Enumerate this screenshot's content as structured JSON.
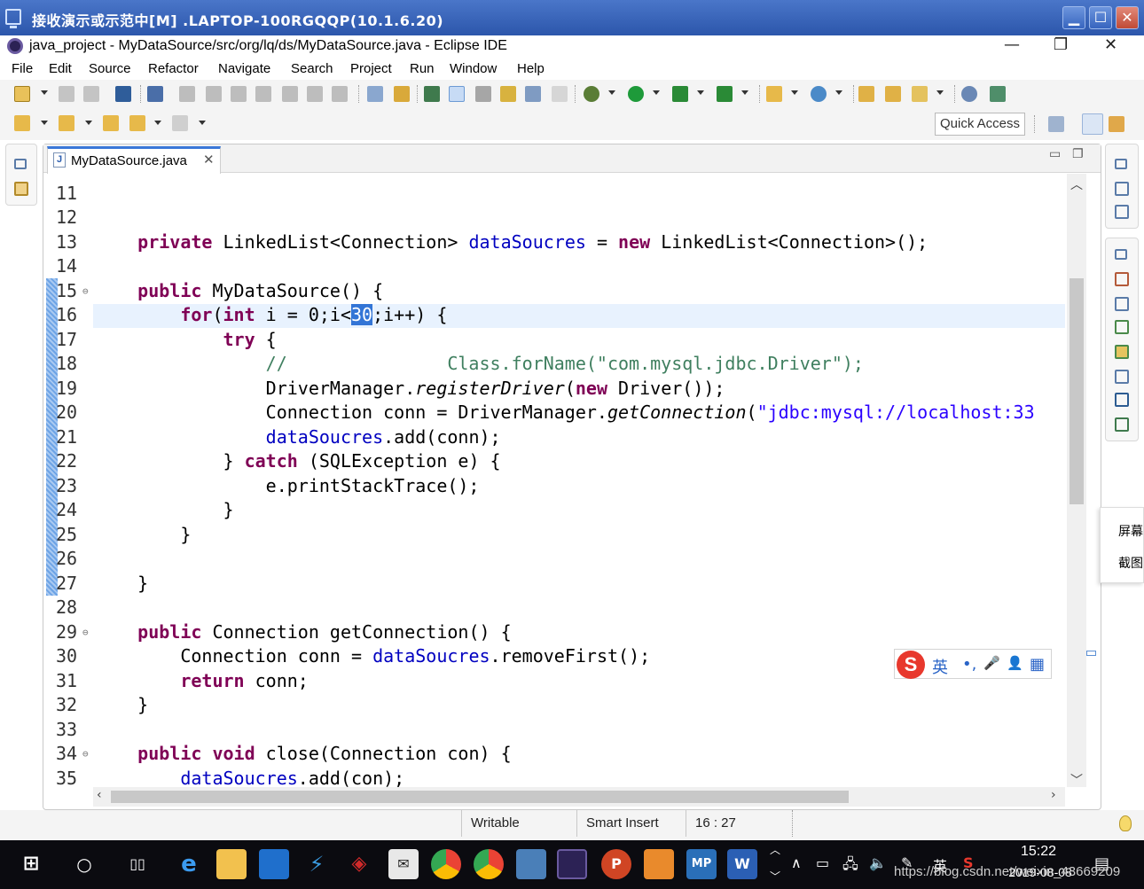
{
  "remote_desktop": {
    "title": "接收演示或示范中[M] .LAPTOP-100RGQQP(10.1.6.20)",
    "min": "▁",
    "max": "☐",
    "close": "✕"
  },
  "window": {
    "title": "java_project - MyDataSource/src/org/lq/ds/MyDataSource.java - Eclipse IDE",
    "min": "—",
    "restore": "❐",
    "close": "✕"
  },
  "menu": [
    "File",
    "Edit",
    "Source",
    "Refactor",
    "Navigate",
    "Search",
    "Project",
    "Run",
    "Window",
    "Help"
  ],
  "quick_access": "Quick Access",
  "editor": {
    "tab_label": "MyDataSource.java",
    "tab_close": "✕",
    "tab_icon": "J",
    "cursor_position": "16 : 27",
    "selected_text": "30"
  },
  "code": {
    "line_numbers": [
      "11",
      "12",
      "13",
      "14",
      "15",
      "16",
      "17",
      "18",
      "19",
      "20",
      "21",
      "22",
      "23",
      "24",
      "25",
      "26",
      "27",
      "28",
      "29",
      "30",
      "31",
      "32",
      "33",
      "34",
      "35"
    ],
    "l13": {
      "kw1": "private",
      "t1": " LinkedList<Connection> ",
      "f1": "dataSoucres",
      "t2": " = ",
      "kw2": "new",
      "t3": " LinkedList<Connection>();"
    },
    "l15": {
      "kw1": "public",
      "t1": " MyDataSource() {"
    },
    "l16": {
      "kw1": "for",
      "t0": "(",
      "kw2": "int",
      "t1": " i = 0;i<",
      "sel": "30",
      "t2": ";i++) {"
    },
    "l17": {
      "kw1": "try",
      "t1": " {"
    },
    "l18": {
      "cmt": "//               Class.forName(\"com.mysql.jdbc.Driver\");"
    },
    "l19": {
      "t1": "DriverManager.",
      "it1": "registerDriver",
      "t2": "(",
      "kw1": "new",
      "t3": " Driver());"
    },
    "l20": {
      "t1": "Connection conn = DriverManager.",
      "it1": "getConnection",
      "t2": "(",
      "str1": "\"jdbc:mysql://localhost:33"
    },
    "l21": {
      "f1": "dataSoucres",
      "t1": ".add(conn);"
    },
    "l22": {
      "t0": "} ",
      "kw1": "catch",
      "t1": " (SQLException e) {"
    },
    "l23": {
      "t1": "e.printStackTrace();"
    },
    "l24": {
      "t1": "}"
    },
    "l25": {
      "t1": "}"
    },
    "l27": {
      "t1": "}"
    },
    "l29": {
      "kw1": "public",
      "t1": " Connection getConnection() {"
    },
    "l30": {
      "t1": "Connection conn = ",
      "f1": "dataSoucres",
      "t2": ".removeFirst();"
    },
    "l31": {
      "kw1": "return",
      "t1": " conn;"
    },
    "l32": {
      "t1": "}"
    },
    "l34": {
      "kw1": "public",
      "t0": " ",
      "kw2": "void",
      "t1": " close(Connection con) {"
    },
    "l35": {
      "f1": "dataSoucres",
      "t1": ".add(con);"
    }
  },
  "statusbar": {
    "writable": "Writable",
    "insert_mode": "Smart Insert",
    "position": "16 : 27"
  },
  "ime": {
    "lang": "英",
    "dot": "•,",
    "mic": "🎤",
    "user": "👤",
    "grid": "▦"
  },
  "snap_popup": {
    "line1": "屏幕",
    "line2": "截图"
  },
  "taskbar": {
    "time": "15:22",
    "date": "2019-08-08",
    "ime_lang": "英",
    "watermark": "https://blog.csdn.net/weixin_43669209"
  }
}
